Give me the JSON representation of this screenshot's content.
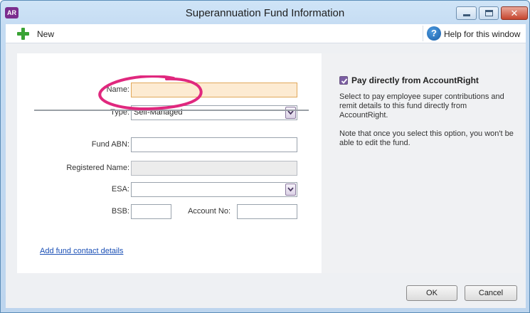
{
  "window": {
    "app_logo": "AR",
    "title": "Superannuation Fund Information",
    "controls": {
      "minimize_icon": "minimize-icon",
      "maximize_icon": "maximize-icon",
      "close_glyph": "✕"
    }
  },
  "toolbar": {
    "new_label": "New",
    "new_icon": "plus-icon",
    "help_label": "Help for this window",
    "help_glyph": "?"
  },
  "form": {
    "name": {
      "label": "Name:",
      "value": ""
    },
    "type": {
      "label": "Type:",
      "value": "Self-Managed"
    },
    "fund_abn": {
      "label": "Fund ABN:",
      "value": ""
    },
    "registered_name": {
      "label": "Registered Name:",
      "value": ""
    },
    "esa": {
      "label": "ESA:",
      "value": ""
    },
    "bsb": {
      "label": "BSB:",
      "value": ""
    },
    "account_no": {
      "label": "Account No:",
      "value": ""
    },
    "contact_link": "Add fund contact details"
  },
  "pay_direct": {
    "checked": true,
    "label": "Pay directly from AccountRight",
    "description": "Select to pay employee super contributions and remit details to this fund directly from AccountRight.",
    "note": "Note that once you select this option, you won't be able to edit the fund."
  },
  "buttons": {
    "ok": "OK",
    "cancel": "Cancel"
  },
  "colors": {
    "annotation": "#e0287e",
    "name_field_bg": "#fdebd2",
    "name_field_border": "#e1a85a",
    "link": "#1a4fb5",
    "checkbox": "#7b5ea3",
    "title_bar": "#c4dbf2"
  }
}
